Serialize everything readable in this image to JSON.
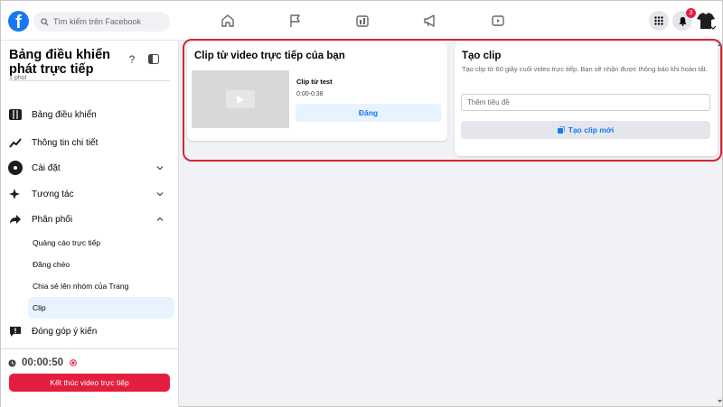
{
  "topbar": {
    "logo_letter": "f",
    "search_placeholder": "Tìm kiếm trên Facebook",
    "nav_icons": [
      "home-icon",
      "flag-icon",
      "marketplace-icon",
      "megaphone-icon",
      "video-icon"
    ],
    "notification_count": "3"
  },
  "sidebar": {
    "title": "Bảng điều khiển phát trực tiếp",
    "partial_text": "1 phút",
    "items": [
      {
        "label": "Bảng điều khiển",
        "icon": "columns-icon"
      },
      {
        "label": "Thông tin chi tiết",
        "icon": "insights-icon"
      },
      {
        "label": "Cài đặt",
        "icon": "gear-icon"
      },
      {
        "label": "Tương tác",
        "icon": "sparkle-icon"
      },
      {
        "label": "Phân phối",
        "icon": "share-icon"
      }
    ],
    "sub_items": [
      "Quảng cáo trực tiếp",
      "Đăng chéo",
      "Chia sẻ lên nhóm của Trang",
      "Clip"
    ],
    "feedback_label": "Đóng góp ý kiến",
    "timer": "00:00:50",
    "end_button": "Kết thúc video trực tiếp"
  },
  "main": {
    "clip_card": {
      "title": "Clip từ video trực tiếp của bạn",
      "clip_name": "Clip từ test",
      "clip_time": "0:00-0:38",
      "post_button": "Đăng"
    },
    "create_card": {
      "title": "Tạo clip",
      "description": "Tạo clip từ 60 giây cuối video trực tiếp. Bạn sẽ nhận được thông báo khi hoàn tất.",
      "input_placeholder": "Thêm tiêu đề",
      "button": "Tạo clip mới"
    }
  },
  "colors": {
    "brand": "#1877f2",
    "danger": "#e41e3f",
    "highlight": "#d7262d"
  }
}
